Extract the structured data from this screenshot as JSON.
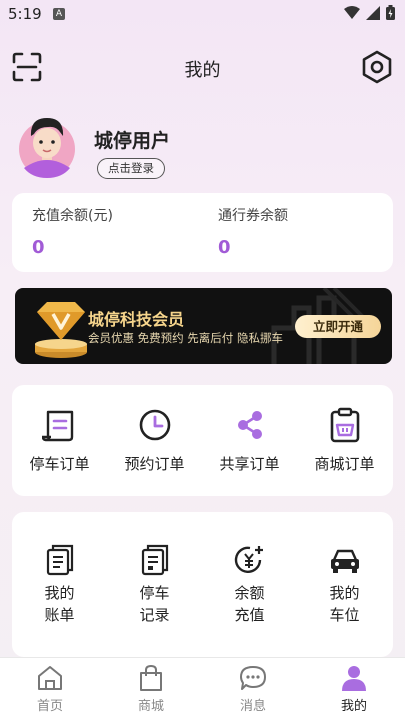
{
  "status": {
    "time": "5:19",
    "notify_icon": "A"
  },
  "header": {
    "title": "我的"
  },
  "profile": {
    "name": "城停用户",
    "login_label": "点击登录"
  },
  "balances": [
    {
      "label": "充值余额(元)",
      "value": "0"
    },
    {
      "label": "通行券余额",
      "value": "0"
    }
  ],
  "vip": {
    "title": "城停科技会员",
    "subtitle": "会员优惠 免费预约 先离后付 隐私挪车",
    "button": "立即开通"
  },
  "orders": [
    {
      "label": "停车订单",
      "icon": "scroll-icon"
    },
    {
      "label": "预约订单",
      "icon": "clock-icon"
    },
    {
      "label": "共享订单",
      "icon": "share-icon"
    },
    {
      "label": "商城订单",
      "icon": "basket-clipboard-icon"
    }
  ],
  "tools": [
    {
      "label": "我的账单",
      "icon": "bill-icon"
    },
    {
      "label": "停车记录",
      "icon": "record-icon"
    },
    {
      "label": "余额充值",
      "icon": "yuan-recharge-icon"
    },
    {
      "label": "我的车位",
      "icon": "car-icon"
    }
  ],
  "tabs": [
    {
      "label": "首页",
      "icon": "home-icon",
      "active": false
    },
    {
      "label": "商城",
      "icon": "shopping-bag-icon",
      "active": false
    },
    {
      "label": "消息",
      "icon": "message-icon",
      "active": false
    },
    {
      "label": "我的",
      "icon": "person-icon",
      "active": true
    }
  ],
  "colors": {
    "accent": "#a15bd6",
    "vip_gold": "#f6d58c",
    "active_tab": "#a96de0"
  }
}
